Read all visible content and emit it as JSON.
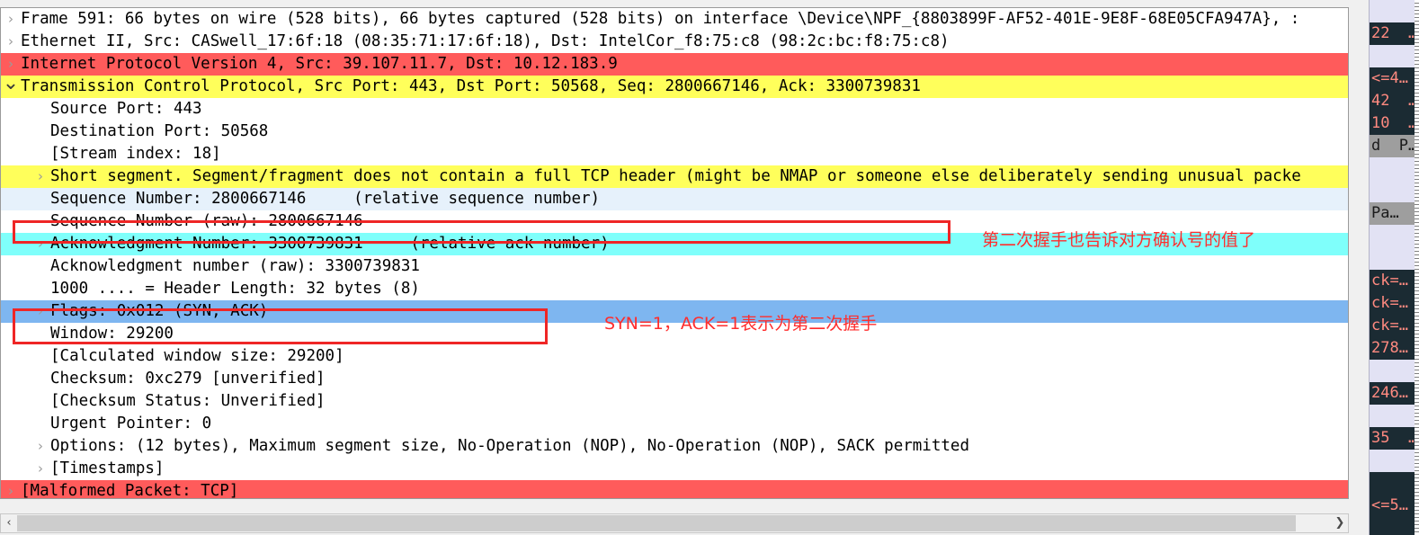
{
  "pane": {
    "name": "packet-details",
    "rows": [
      {
        "text": "Frame 591: 66 bytes on wire (528 bits), 66 bytes captured (528 bits) on interface \\Device\\NPF_{8803899F-AF52-401E-9E8F-68E05CFA947A}, :",
        "twisty": "collapsed",
        "depth": 0,
        "highlight": "none"
      },
      {
        "text": "Ethernet II, Src: CASwell_17:6f:18 (08:35:71:17:6f:18), Dst: IntelCor_f8:75:c8 (98:2c:bc:f8:75:c8)",
        "twisty": "collapsed",
        "depth": 0,
        "highlight": "none"
      },
      {
        "text": "Internet Protocol Version 4, Src: 39.107.11.7, Dst: 10.12.183.9",
        "twisty": "collapsed",
        "depth": 0,
        "highlight": "red"
      },
      {
        "text": "Transmission Control Protocol, Src Port: 443, Dst Port: 50568, Seq: 2800667146, Ack: 3300739831",
        "twisty": "expanded",
        "depth": 0,
        "highlight": "yellow"
      },
      {
        "text": "Source Port: 443",
        "twisty": "none",
        "depth": 1,
        "highlight": "none"
      },
      {
        "text": "Destination Port: 50568",
        "twisty": "none",
        "depth": 1,
        "highlight": "none"
      },
      {
        "text": "[Stream index: 18]",
        "twisty": "none",
        "depth": 1,
        "highlight": "none"
      },
      {
        "text": "Short segment. Segment/fragment does not contain a full TCP header (might be NMAP or someone else deliberately sending unusual packe",
        "twisty": "collapsed",
        "depth": 1,
        "highlight": "yellow"
      },
      {
        "text": "Sequence Number: 2800667146     (relative sequence number)",
        "twisty": "none",
        "depth": 1,
        "highlight": "pale"
      },
      {
        "text": "Sequence Number (raw): 2800667146",
        "twisty": "none",
        "depth": 1,
        "highlight": "white"
      },
      {
        "text": "Acknowledgment Number: 3300739831     (relative ack number)",
        "twisty": "collapsed",
        "depth": 1,
        "highlight": "cyan"
      },
      {
        "text": "Acknowledgment number (raw): 3300739831",
        "twisty": "none",
        "depth": 1,
        "highlight": "none"
      },
      {
        "text": "1000 .... = Header Length: 32 bytes (8)",
        "twisty": "none",
        "depth": 1,
        "highlight": "none"
      },
      {
        "text": "Flags: 0x012 (SYN, ACK)",
        "twisty": "collapsed",
        "depth": 1,
        "highlight": "blue"
      },
      {
        "text": "Window: 29200",
        "twisty": "none",
        "depth": 1,
        "highlight": "none"
      },
      {
        "text": "[Calculated window size: 29200]",
        "twisty": "none",
        "depth": 1,
        "highlight": "none"
      },
      {
        "text": "Checksum: 0xc279 [unverified]",
        "twisty": "none",
        "depth": 1,
        "highlight": "none"
      },
      {
        "text": "[Checksum Status: Unverified]",
        "twisty": "none",
        "depth": 1,
        "highlight": "none"
      },
      {
        "text": "Urgent Pointer: 0",
        "twisty": "none",
        "depth": 1,
        "highlight": "none"
      },
      {
        "text": "Options: (12 bytes), Maximum segment size, No-Operation (NOP), No-Operation (NOP), SACK permitted",
        "twisty": "collapsed",
        "depth": 1,
        "highlight": "none"
      },
      {
        "text": "[Timestamps]",
        "twisty": "collapsed",
        "depth": 1,
        "highlight": "none"
      },
      {
        "text": "[Malformed Packet: TCP]",
        "twisty": "collapsed",
        "depth": 0,
        "highlight": "red"
      }
    ]
  },
  "annotations": [
    {
      "id": "ack-note",
      "text": "第二次握手也告诉对方确认号的值了",
      "color": "#ff2d2d"
    },
    {
      "id": "flags-note",
      "text": "SYN=1，ACK=1表示为第二次握手",
      "color": "#ff2d2d"
    }
  ],
  "redboxes": [
    {
      "id": "sequence-number-raw-box",
      "color": "#ef2626"
    },
    {
      "id": "flags-box",
      "color": "#ef2626"
    }
  ],
  "scrollbar": {
    "left_arrow": "‹",
    "right_arrow": "❯"
  },
  "right_pane": {
    "rows": [
      {
        "text": "",
        "style": "light"
      },
      {
        "text": "22  …",
        "style": "dark"
      },
      {
        "text": "",
        "style": "light"
      },
      {
        "text": "<=4…",
        "style": "dark"
      },
      {
        "text": "42  …",
        "style": "dark"
      },
      {
        "text": "10  …",
        "style": "dark"
      },
      {
        "text": "d  P…",
        "style": "gray"
      },
      {
        "text": "",
        "style": "light"
      },
      {
        "text": "",
        "style": "light"
      },
      {
        "text": "Pa…",
        "style": "gray"
      },
      {
        "text": "",
        "style": "light"
      },
      {
        "text": "",
        "style": "light"
      },
      {
        "text": "ck=…",
        "style": "dark"
      },
      {
        "text": "ck=…",
        "style": "dark"
      },
      {
        "text": "ck=…",
        "style": "dark"
      },
      {
        "text": "278…",
        "style": "dark"
      },
      {
        "text": "",
        "style": "light"
      },
      {
        "text": "246…",
        "style": "dark"
      },
      {
        "text": "",
        "style": "light"
      },
      {
        "text": "35  …",
        "style": "dark"
      },
      {
        "text": "",
        "style": "light"
      },
      {
        "text": "",
        "style": "dark"
      },
      {
        "text": "<=5…",
        "style": "dark"
      },
      {
        "text": "",
        "style": "dark"
      }
    ]
  },
  "colors": {
    "highlight_red": "#ff5b5b",
    "highlight_yellow": "#ffff5b",
    "highlight_cyan": "#7ffffb",
    "highlight_selected_blue": "#7eb6f0",
    "highlight_pale_blue": "#e6f1fb",
    "annotation_red": "#ff2d2d",
    "box_red": "#ef2626"
  }
}
